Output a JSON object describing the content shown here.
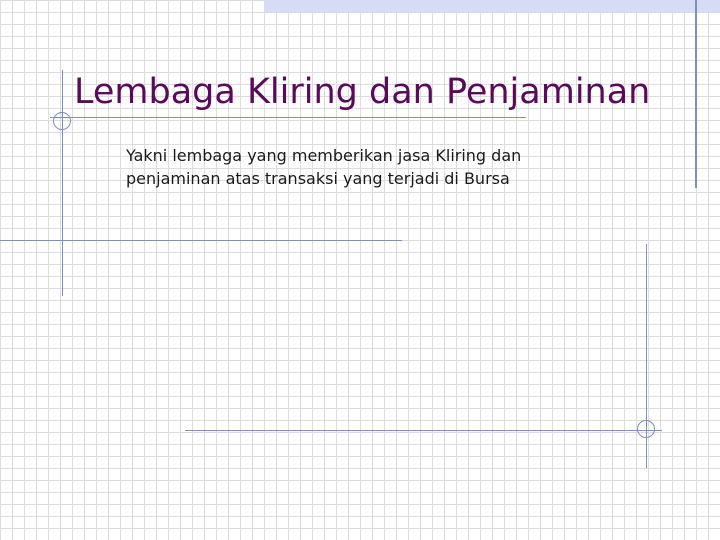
{
  "slide": {
    "title": "Lembaga Kliring dan Penjaminan",
    "body_text": "Yakni lembaga yang memberikan jasa Kliring dan penjaminan atas transaksi yang terjadi di Bursa"
  },
  "colors": {
    "title": "#5a0a5a",
    "body_text": "#1a1a1a",
    "decor_line": "#7f8fb8",
    "top_band": "#d6dcf5",
    "grid": "#dcdcdc"
  }
}
